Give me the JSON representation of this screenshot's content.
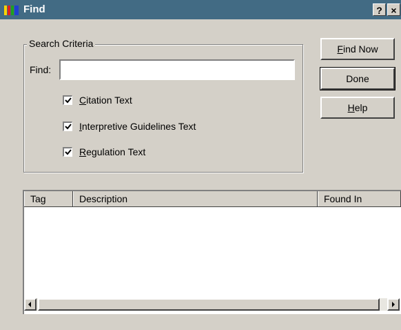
{
  "window": {
    "title": "Find",
    "help_glyph": "?",
    "close_glyph": "×"
  },
  "search_criteria": {
    "group_label": "Search Criteria",
    "find_label": "Find:",
    "find_value": "",
    "checkboxes": [
      {
        "mnemonic": "C",
        "rest": "itation Text",
        "checked": true
      },
      {
        "mnemonic": "I",
        "rest": "nterpretive Guidelines Text",
        "checked": true
      },
      {
        "mnemonic": "R",
        "rest": "egulation Text",
        "checked": true
      }
    ]
  },
  "buttons": {
    "find_now": {
      "mnemonic": "F",
      "rest": "ind Now"
    },
    "done": "Done",
    "help": {
      "mnemonic": "H",
      "rest": "elp"
    }
  },
  "results": {
    "columns": [
      "Tag",
      "Description",
      "Found In"
    ],
    "rows": []
  },
  "colors": {
    "titlebar": "#426b84",
    "face": "#d4d0c8"
  }
}
